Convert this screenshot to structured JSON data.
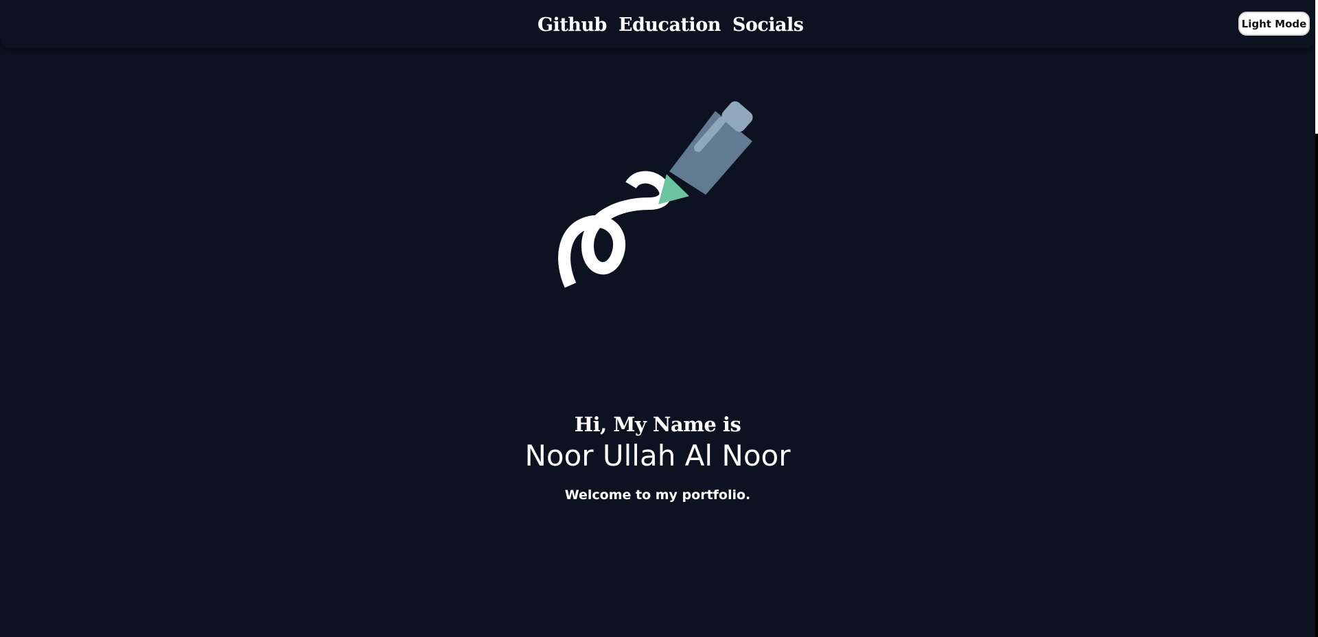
{
  "nav": {
    "items": [
      {
        "label": "Github"
      },
      {
        "label": "Education"
      },
      {
        "label": "Socials"
      }
    ]
  },
  "theme_toggle": {
    "label": "Light Mode"
  },
  "hero": {
    "greeting": "Hi, My Name is",
    "name": "Noor Ullah Al Noor",
    "tagline": "Welcome to my portfolio.",
    "illustration": "pencil-drawing-scribble"
  },
  "colors": {
    "background": "#0d1220",
    "text": "#ffffff",
    "pencil_body": "#637a93",
    "pencil_cap": "#90a7bc",
    "pencil_tip": "#6cc3a0"
  }
}
